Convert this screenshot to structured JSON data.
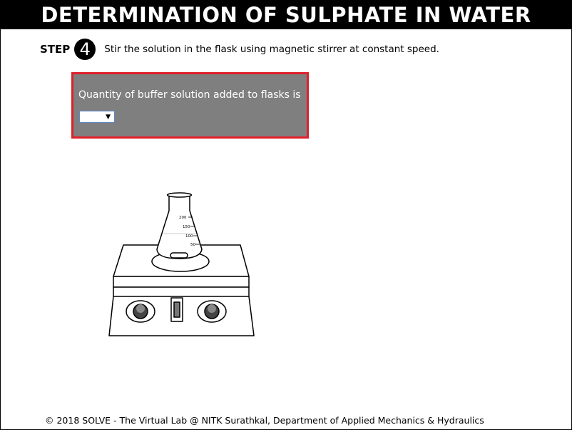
{
  "header": {
    "title": "DETERMINATION OF SULPHATE IN WATER"
  },
  "step": {
    "label": "STEP",
    "number": "4",
    "instruction": "Stir the solution in the flask using magnetic stirrer at constant speed."
  },
  "question": {
    "text": "Quantity of buffer solution added to flasks is",
    "selected_value": "",
    "dropdown_arrow": "▼"
  },
  "flask": {
    "graduations": [
      "200",
      "150",
      "100",
      "50"
    ]
  },
  "footer": {
    "text": "© 2018 SOLVE - The Virtual Lab @ NITK Surathkal, Department of Applied Mechanics & Hydraulics"
  },
  "colors": {
    "title_bar": "#000000",
    "question_box": "#7f7f7f",
    "question_border": "#e0202a"
  }
}
